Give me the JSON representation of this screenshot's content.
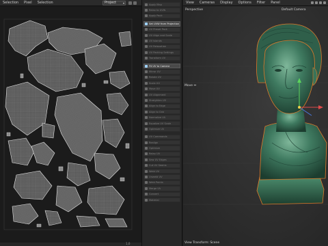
{
  "uv_editor": {
    "menu": [
      "Selection",
      "Pixel",
      "Selection"
    ],
    "dropdown_value": "Project",
    "corner_label": "1,0"
  },
  "tools": {
    "items": [
      {
        "label": "Apply Map",
        "active": false
      },
      {
        "label": "Relax to UVW",
        "active": false
      },
      {
        "label": "Apply Pack",
        "active": false
      },
      {
        "label": "Set UVW from Projection",
        "active": true
      },
      {
        "label": "UV Preset Pack",
        "active": false
      },
      {
        "label": "UV Align and Scale",
        "active": false
      },
      {
        "label": "UV Islands",
        "active": false
      },
      {
        "label": "UV Relaxation",
        "active": false
      },
      {
        "label": "UV Packing Settings",
        "active": false
      },
      {
        "label": "Transform UV",
        "active": false
      },
      {
        "label": "Fit UV to Camera",
        "active": true
      },
      {
        "label": "Mirror UV",
        "active": false
      },
      {
        "label": "Rotate UV",
        "active": false
      },
      {
        "label": "Scale UV",
        "active": false
      },
      {
        "label": "Move UV",
        "active": false
      },
      {
        "label": "UV Alignment",
        "active": false
      },
      {
        "label": "Straighten UV",
        "active": false
      },
      {
        "label": "Align to Edge",
        "active": false
      },
      {
        "label": "Align to Grid",
        "active": false
      },
      {
        "label": "Normalize UV",
        "active": false
      },
      {
        "label": "Equalize UV Scale",
        "active": false
      },
      {
        "label": "Optimize UV",
        "active": false
      },
      {
        "label": "UV Commands",
        "active": false
      },
      {
        "label": "Realign",
        "active": false
      },
      {
        "label": "Optimize",
        "active": false
      },
      {
        "label": "Relax UV",
        "active": false
      },
      {
        "label": "Sew UV Edges",
        "active": false
      },
      {
        "label": "Cut UV Seams",
        "active": false
      },
      {
        "label": "Weld UV",
        "active": false
      },
      {
        "label": "Unweld UV",
        "active": false
      },
      {
        "label": "Weld Points",
        "active": false
      },
      {
        "label": "Merge UV",
        "active": false
      },
      {
        "label": "Convert",
        "active": false
      },
      {
        "label": "Material",
        "active": false
      }
    ]
  },
  "viewport": {
    "menu": [
      "View",
      "Cameras",
      "Display",
      "Options",
      "Filter",
      "Panel"
    ],
    "perspective_label": "Perspective",
    "camera_label": "Default Camera",
    "move_label": "Move ⇔",
    "bottom_label": "View Transform: Scene"
  },
  "colors": {
    "uv_wire": "#cfcfcf",
    "marble_green": "#3f7a60",
    "selection_orange": "#e07a2a",
    "active_tool": "#4a4a4a"
  }
}
